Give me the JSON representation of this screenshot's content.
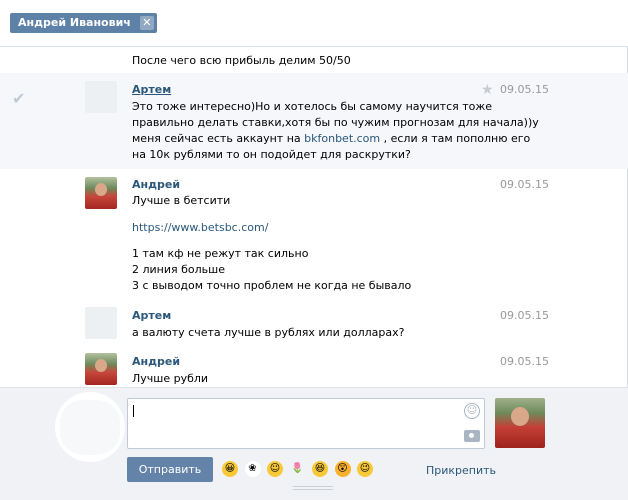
{
  "header": {
    "chip_label": "Андрей Иванович",
    "chip_close": "✕"
  },
  "messages": {
    "m0": {
      "line": "После чего всю прибыль делим 50/50"
    },
    "m1": {
      "author": "Артем",
      "date": "09.05.15",
      "line1": "Это тоже интересно)Но и хотелось бы самому научится тоже",
      "line2": "правильно делать ставки,хотя бы по чужим прогнозам для начала))у",
      "line3a": "меня сейчас есть аккаунт на ",
      "line3link": "bkfonbet.com",
      "line3b": " , если я там пополню его",
      "line4": "на 10к рублями то он подойдет для раскрутки?"
    },
    "m2": {
      "author": "Андрей",
      "date": "09.05.15",
      "line1": "Лучше в бетсити",
      "link": "https://www.betsbc.com/",
      "l1": "1 там кф не режут так сильно",
      "l2": "2 линия больше",
      "l3": "3 с выводом точно проблем не когда не бывало"
    },
    "m3": {
      "author": "Артем",
      "date": "09.05.15",
      "line1": "а валюту счета лучше в рублях или долларах?"
    },
    "m4": {
      "author": "Андрей",
      "date": "09.05.15",
      "line1": "Лучше рубли"
    }
  },
  "composer": {
    "send_label": "Отправить",
    "attach_label": "Прикрепить",
    "emoji": [
      {
        "name": "grin",
        "glyph": "😀",
        "bg": "#f7c938"
      },
      {
        "name": "flower",
        "glyph": "❀",
        "bg": "#ffffff"
      },
      {
        "name": "smile",
        "glyph": "☺",
        "bg": "#f7c938"
      },
      {
        "name": "tulip",
        "glyph": "🌷",
        "bg": "#f0f2f5"
      },
      {
        "name": "laugh",
        "glyph": "😆",
        "bg": "#f7c938"
      },
      {
        "name": "shock",
        "glyph": "😲",
        "bg": "#f7b030"
      },
      {
        "name": "wink",
        "glyph": "😉",
        "bg": "#f7c938"
      }
    ]
  }
}
